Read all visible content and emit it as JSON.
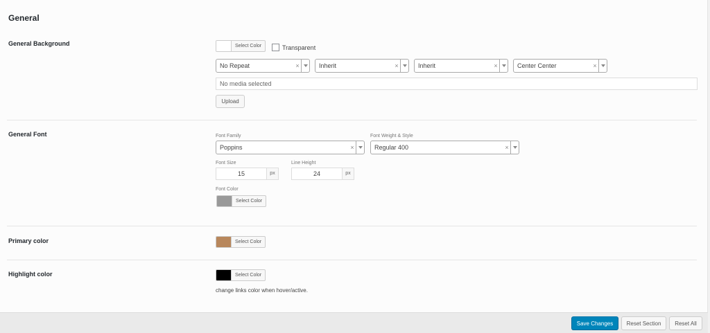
{
  "section": {
    "title": "General"
  },
  "rows": {
    "general_background": {
      "label": "General Background",
      "color_button": "Select Color",
      "swatch_color": "#ffffff",
      "transparent_label": "Transparent",
      "selects": [
        "No Repeat",
        "Inherit",
        "Inherit",
        "Center Center"
      ],
      "clear_symbol": "×",
      "media_placeholder": "No media selected",
      "upload_button": "Upload"
    },
    "general_font": {
      "label": "General Font",
      "font_family_label": "Font Family",
      "font_family_value": "Poppins",
      "font_weight_label": "Font Weight & Style",
      "font_weight_value": "Regular 400",
      "font_size_label": "Font Size",
      "font_size_value": "15",
      "line_height_label": "Line Height",
      "line_height_value": "24",
      "unit": "px",
      "font_color_label": "Font Color",
      "color_button": "Select Color",
      "swatch_color": "#999999"
    },
    "primary_color": {
      "label": "Primary color",
      "color_button": "Select Color",
      "swatch_color": "#b8875c"
    },
    "highlight_color": {
      "label": "Highlight color",
      "color_button": "Select Color",
      "swatch_color": "#000000",
      "description": "change links color when hover/active."
    }
  },
  "footer": {
    "save_label": "Save Changes",
    "reset_section_label": "Reset Section",
    "reset_all_label": "Reset All"
  },
  "colors": {
    "accent": "#0085ba"
  }
}
